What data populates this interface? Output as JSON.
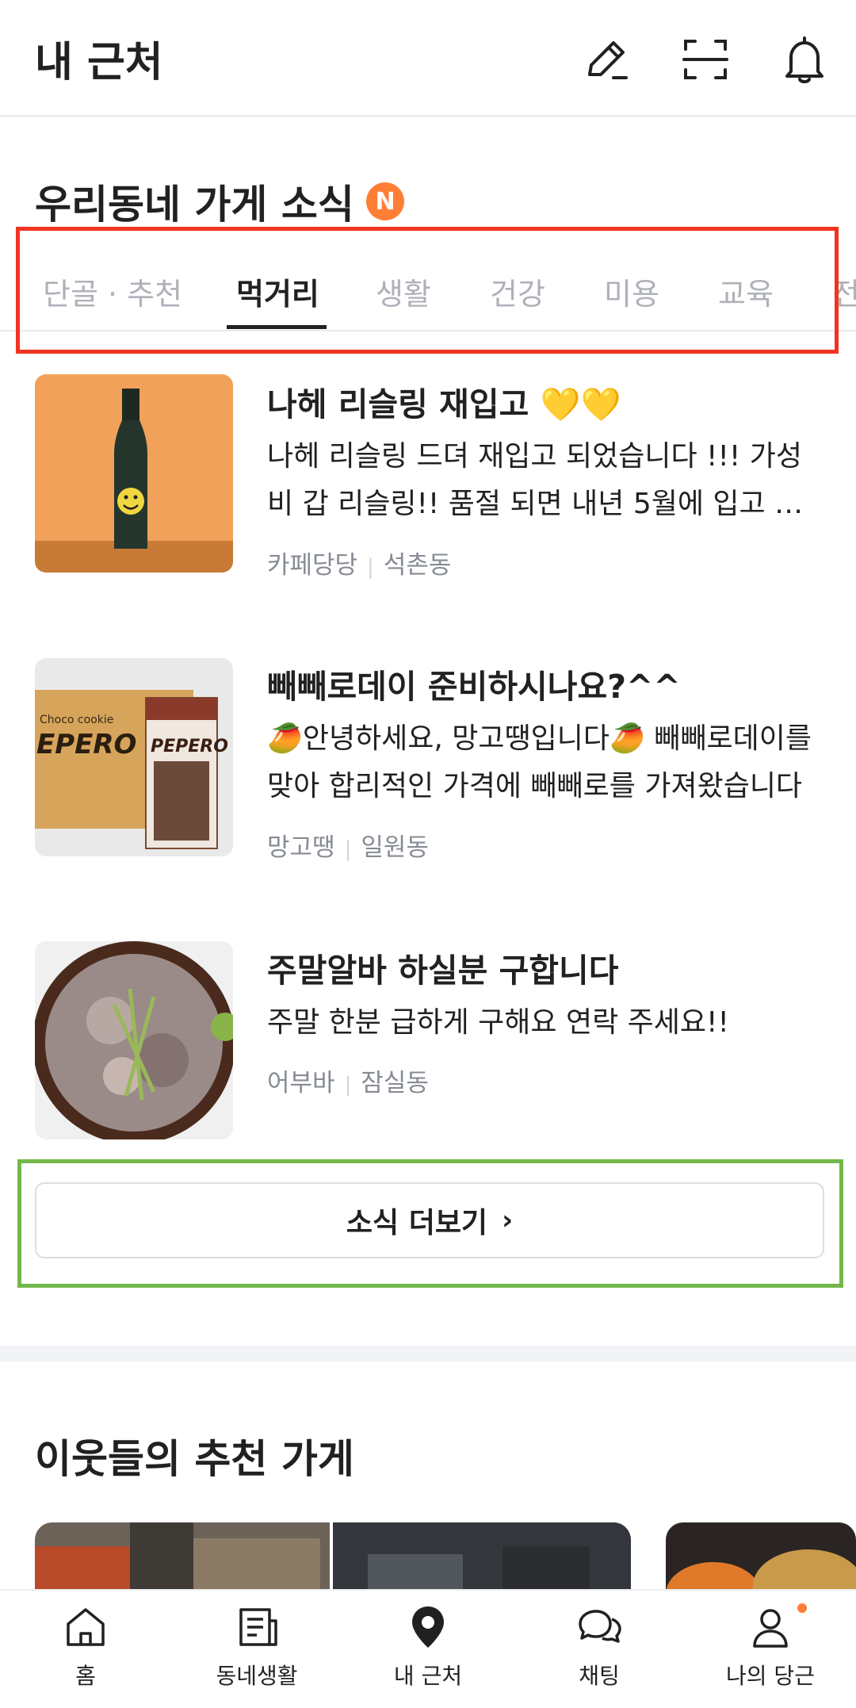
{
  "header": {
    "title": "내 근처"
  },
  "news": {
    "title": "우리동네 가게 소식",
    "badge": "N",
    "tabs": [
      "단골 · 추천",
      "먹거리",
      "생활",
      "건강",
      "미용",
      "교육",
      "전"
    ],
    "items": [
      {
        "title": "나헤 리슬링 재입고 💛💛",
        "body": "나헤 리슬링 드뎌 재입고 되었습니다 !!! 가성비 갑 리슬링!! 품절 되면 내년 5월에 입고 됩니다",
        "store": "카페당당",
        "area": "석촌동"
      },
      {
        "title": "빼빼로데이 준비하시나요?^^",
        "body": "🥭안녕하세요, 망고땡입니다🥭 빼빼로데이를 맞아 합리적인 가격에 빼빼로를 가져왔습니다",
        "store": "망고땡",
        "area": "일원동"
      },
      {
        "title": "주말알바 하실분 구합니다",
        "body": "주말 한분 급하게 구해요 연락 주세요!!",
        "store": "어부바",
        "area": "잠실동"
      }
    ],
    "more_label": "소식 더보기"
  },
  "recommend": {
    "title": "이웃들의 추천 가게"
  },
  "nav": {
    "items": [
      {
        "label": "홈"
      },
      {
        "label": "동네생활"
      },
      {
        "label": "내 근처"
      },
      {
        "label": "채팅"
      },
      {
        "label": "나의 당근"
      }
    ]
  },
  "colors": {
    "accent": "#ff7e36",
    "highlight_red": "#f1331f",
    "highlight_green": "#73b84a"
  }
}
